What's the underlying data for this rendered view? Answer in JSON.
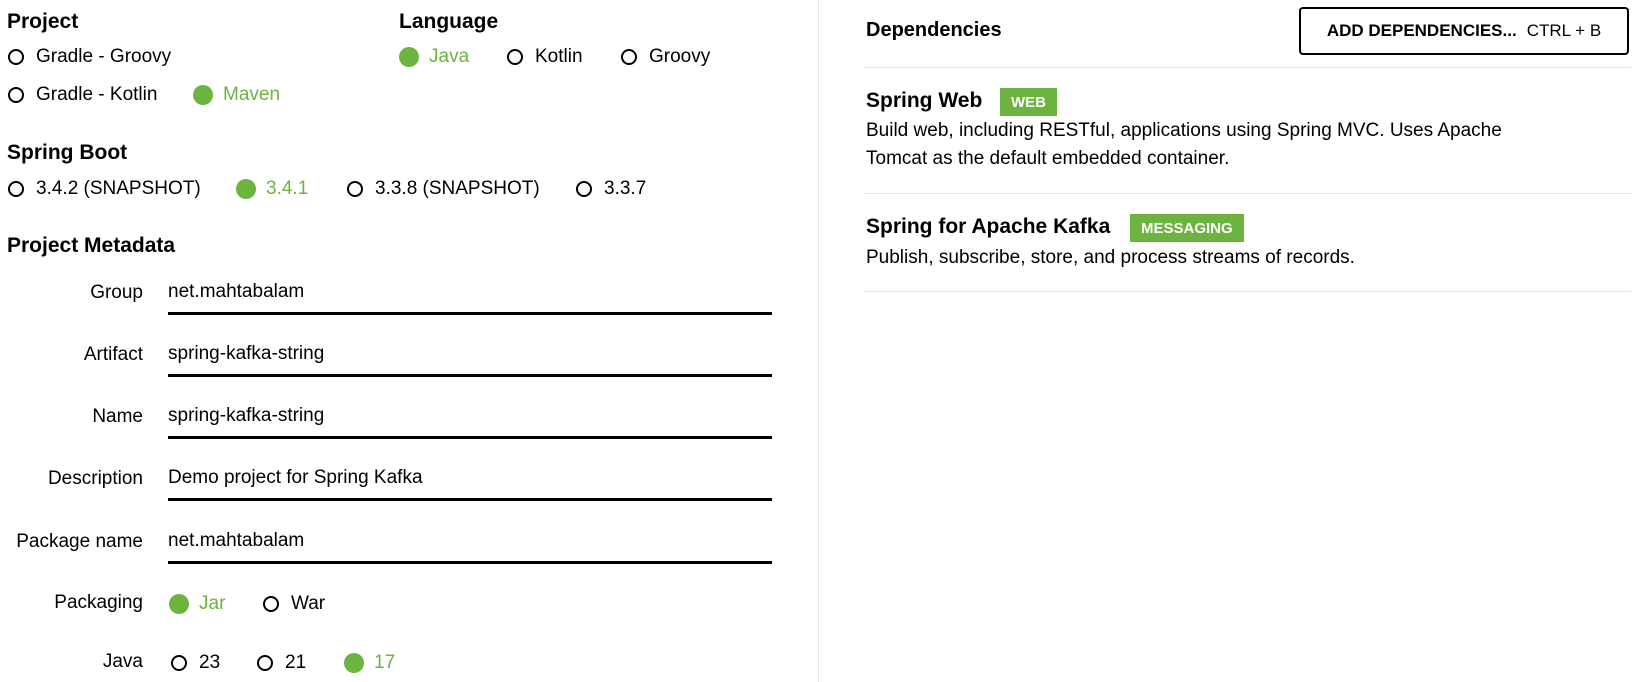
{
  "project": {
    "title": "Project",
    "options": [
      "Gradle - Groovy",
      "Gradle - Kotlin",
      "Maven"
    ],
    "selected": "Maven"
  },
  "language": {
    "title": "Language",
    "options": [
      "Java",
      "Kotlin",
      "Groovy"
    ],
    "selected": "Java"
  },
  "spring_boot": {
    "title": "Spring Boot",
    "options": [
      "3.4.2 (SNAPSHOT)",
      "3.4.1",
      "3.3.8 (SNAPSHOT)",
      "3.3.7"
    ],
    "selected": "3.4.1"
  },
  "metadata": {
    "title": "Project Metadata",
    "fields": [
      {
        "label": "Group",
        "value": "net.mahtabalam"
      },
      {
        "label": "Artifact",
        "value": "spring-kafka-string"
      },
      {
        "label": "Name",
        "value": "spring-kafka-string"
      },
      {
        "label": "Description",
        "value": "Demo project for Spring Kafka"
      },
      {
        "label": "Package name",
        "value": "net.mahtabalam"
      }
    ],
    "packaging": {
      "label": "Packaging",
      "options": [
        "Jar",
        "War"
      ],
      "selected": "Jar"
    },
    "java": {
      "label": "Java",
      "options": [
        "23",
        "21",
        "17"
      ],
      "selected": "17"
    }
  },
  "dependencies": {
    "title": "Dependencies",
    "add_button": {
      "label": "ADD DEPENDENCIES...",
      "shortcut": "CTRL + B"
    },
    "items": [
      {
        "name": "Spring Web",
        "badge": "WEB",
        "description": "Build web, including RESTful, applications using Spring MVC. Uses Apache Tomcat as the default embedded container."
      },
      {
        "name": "Spring for Apache Kafka",
        "badge": "MESSAGING",
        "description": "Publish, subscribe, store, and process streams of records."
      }
    ]
  },
  "colors": {
    "accent": "#6db33f",
    "divider": "#e6e6e6"
  }
}
